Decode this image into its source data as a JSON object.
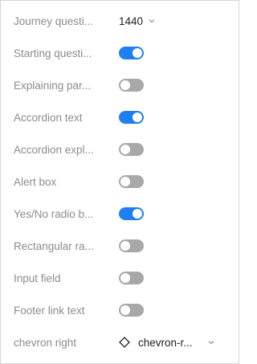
{
  "rows": [
    {
      "label": "Journey questi...",
      "type": "select",
      "value": "1440"
    },
    {
      "label": "Starting questi...",
      "type": "toggle",
      "on": true
    },
    {
      "label": "Explaining par...",
      "type": "toggle",
      "on": false
    },
    {
      "label": "Accordion text",
      "type": "toggle",
      "on": true
    },
    {
      "label": "Accordion expl...",
      "type": "toggle",
      "on": false
    },
    {
      "label": "Alert box",
      "type": "toggle",
      "on": false
    },
    {
      "label": "Yes/No radio b...",
      "type": "toggle",
      "on": true
    },
    {
      "label": "Rectangular ra...",
      "type": "toggle",
      "on": false
    },
    {
      "label": "Input field",
      "type": "toggle",
      "on": false
    },
    {
      "label": "Footer link text",
      "type": "toggle",
      "on": false
    },
    {
      "label": "chevron right",
      "type": "icon-select",
      "icon": "diamond-icon",
      "value": "chevron-r..."
    }
  ],
  "colors": {
    "toggle_on": "#1e7ff0",
    "toggle_off": "#a8a8a8",
    "label": "#8c8c8c"
  }
}
